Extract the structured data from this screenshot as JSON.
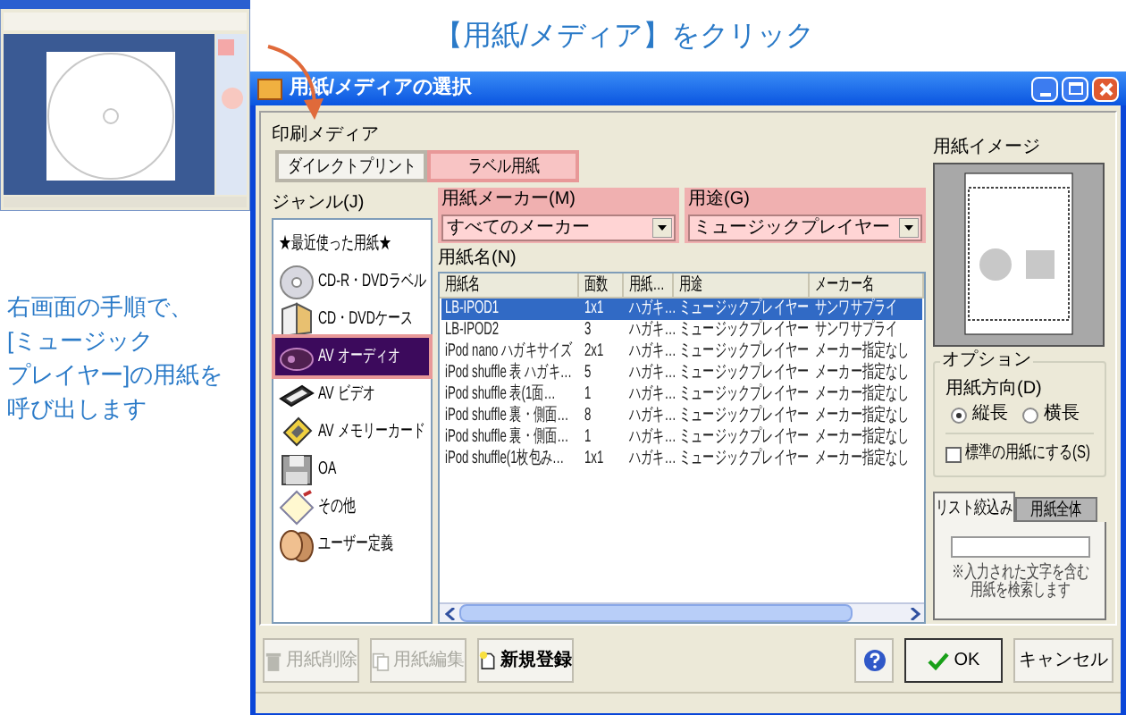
{
  "callout": {
    "text": "【用紙/メディア】をクリック"
  },
  "instructions": [
    "右画面の手順で、",
    "[ミュージック",
    "プレイヤー]の用紙を",
    "呼び出します"
  ],
  "dialog": {
    "title": "用紙/メディアの選択",
    "media_label": "印刷メディア",
    "media_tabs": [
      {
        "label": "ダイレクトプリント",
        "selected": false
      },
      {
        "label": "ラベル用紙",
        "selected": true
      }
    ],
    "genre_label": "ジャンル(J)",
    "genres": [
      {
        "label": "★最近使った用紙★",
        "selected": false
      },
      {
        "label": "CD-R・DVDラベル",
        "selected": false
      },
      {
        "label": "CD・DVDケース",
        "selected": false
      },
      {
        "label": "AV オーディオ",
        "selected": true
      },
      {
        "label": "AV ビデオ",
        "selected": false
      },
      {
        "label": "AV メモリーカード",
        "selected": false
      },
      {
        "label": "OA",
        "selected": false
      },
      {
        "label": "その他",
        "selected": false
      },
      {
        "label": "ユーザー定義",
        "selected": false
      }
    ],
    "maker": {
      "label": "用紙メーカー(M)",
      "value": "すべてのメーカー"
    },
    "usage": {
      "label": "用途(G)",
      "value": "ミュージックプレイヤー"
    },
    "paper_label": "用紙名(N)",
    "table": {
      "columns": [
        "用紙名",
        "面数",
        "用紙…",
        "用途",
        "メーカー名"
      ],
      "rows": [
        {
          "cells": [
            "LB-IPOD1",
            "1x1",
            "ハガキ…",
            "ミュージックプレイヤー",
            "サンワサプライ"
          ],
          "selected": true
        },
        {
          "cells": [
            "LB-IPOD2",
            "3",
            "ハガキ…",
            "ミュージックプレイヤー",
            "サンワサプライ"
          ],
          "selected": false
        },
        {
          "cells": [
            "iPod nano ハガキサイズ",
            "2x1",
            "ハガキ…",
            "ミュージックプレイヤー",
            "メーカー指定なし"
          ],
          "selected": false
        },
        {
          "cells": [
            "iPod shuffle 表 ハガキ…",
            "5",
            "ハガキ…",
            "ミュージックプレイヤー",
            "メーカー指定なし"
          ],
          "selected": false
        },
        {
          "cells": [
            "iPod shuffle 表(1面…",
            "1",
            "ハガキ…",
            "ミュージックプレイヤー",
            "メーカー指定なし"
          ],
          "selected": false
        },
        {
          "cells": [
            "iPod shuffle 裏・側面…",
            "8",
            "ハガキ…",
            "ミュージックプレイヤー",
            "メーカー指定なし"
          ],
          "selected": false
        },
        {
          "cells": [
            "iPod shuffle 裏・側面…",
            "1",
            "ハガキ…",
            "ミュージックプレイヤー",
            "メーカー指定なし"
          ],
          "selected": false
        },
        {
          "cells": [
            "iPod shuffle(1枚包み…",
            "1x1",
            "ハガキ…",
            "ミュージックプレイヤー",
            "メーカー指定なし"
          ],
          "selected": false
        }
      ]
    },
    "preview_label": "用紙イメージ",
    "options": {
      "title": "オプション",
      "orientation_label": "用紙方向(D)",
      "orientations": [
        {
          "label": "縦長",
          "selected": true
        },
        {
          "label": "横長",
          "selected": false
        }
      ],
      "default_paper": {
        "label": "標準の用紙にする(S)",
        "checked": false
      }
    },
    "filter_tabs": [
      {
        "label": "リスト絞込み",
        "selected": true
      },
      {
        "label": "用紙全体",
        "selected": false
      }
    ],
    "filter_note": [
      "※入力された文字を含む",
      "用紙を検索します"
    ],
    "buttons": [
      {
        "kind": "delete",
        "label": "用紙削除",
        "disabled": true
      },
      {
        "kind": "edit",
        "label": "用紙編集",
        "disabled": true
      },
      {
        "kind": "new",
        "label": "新規登録",
        "disabled": false
      }
    ],
    "ok_button": {
      "label": "OK"
    },
    "cancel_button": {
      "label": "キャンセル"
    }
  }
}
